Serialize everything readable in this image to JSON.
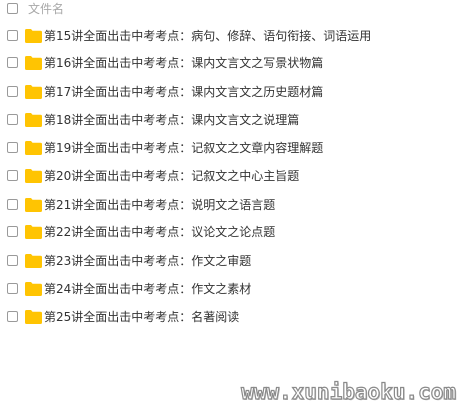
{
  "header": {
    "column_label": "文件名"
  },
  "folder_color": "#FFC402",
  "files": [
    {
      "name": "第15讲全面出击中考考点：病句、修辞、语句衔接、词语运用",
      "icon": "folder-icon"
    },
    {
      "name": "第16讲全面出击中考考点：课内文言文之写景状物篇",
      "icon": "folder-icon"
    },
    {
      "name": "第17讲全面出击中考考点：课内文言文之历史题材篇",
      "icon": "folder-icon"
    },
    {
      "name": "第18讲全面出击中考考点：课内文言文之说理篇",
      "icon": "folder-icon"
    },
    {
      "name": "第19讲全面出击中考考点：记叙文之文章内容理解题",
      "icon": "folder-icon"
    },
    {
      "name": "第20讲全面出击中考考点：记叙文之中心主旨题",
      "icon": "folder-icon"
    },
    {
      "name": "第21讲全面出击中考考点：说明文之语言题",
      "icon": "folder-icon"
    },
    {
      "name": "第22讲全面出击中考考点：议论文之论点题",
      "icon": "folder-icon"
    },
    {
      "name": "第23讲全面出击中考考点：作文之审题",
      "icon": "folder-icon"
    },
    {
      "name": "第24讲全面出击中考考点：作文之素材",
      "icon": "folder-icon"
    },
    {
      "name": "第25讲全面出击中考考点：名著阅读",
      "icon": "folder-icon"
    }
  ],
  "watermark": "www.xunibaoku.com"
}
